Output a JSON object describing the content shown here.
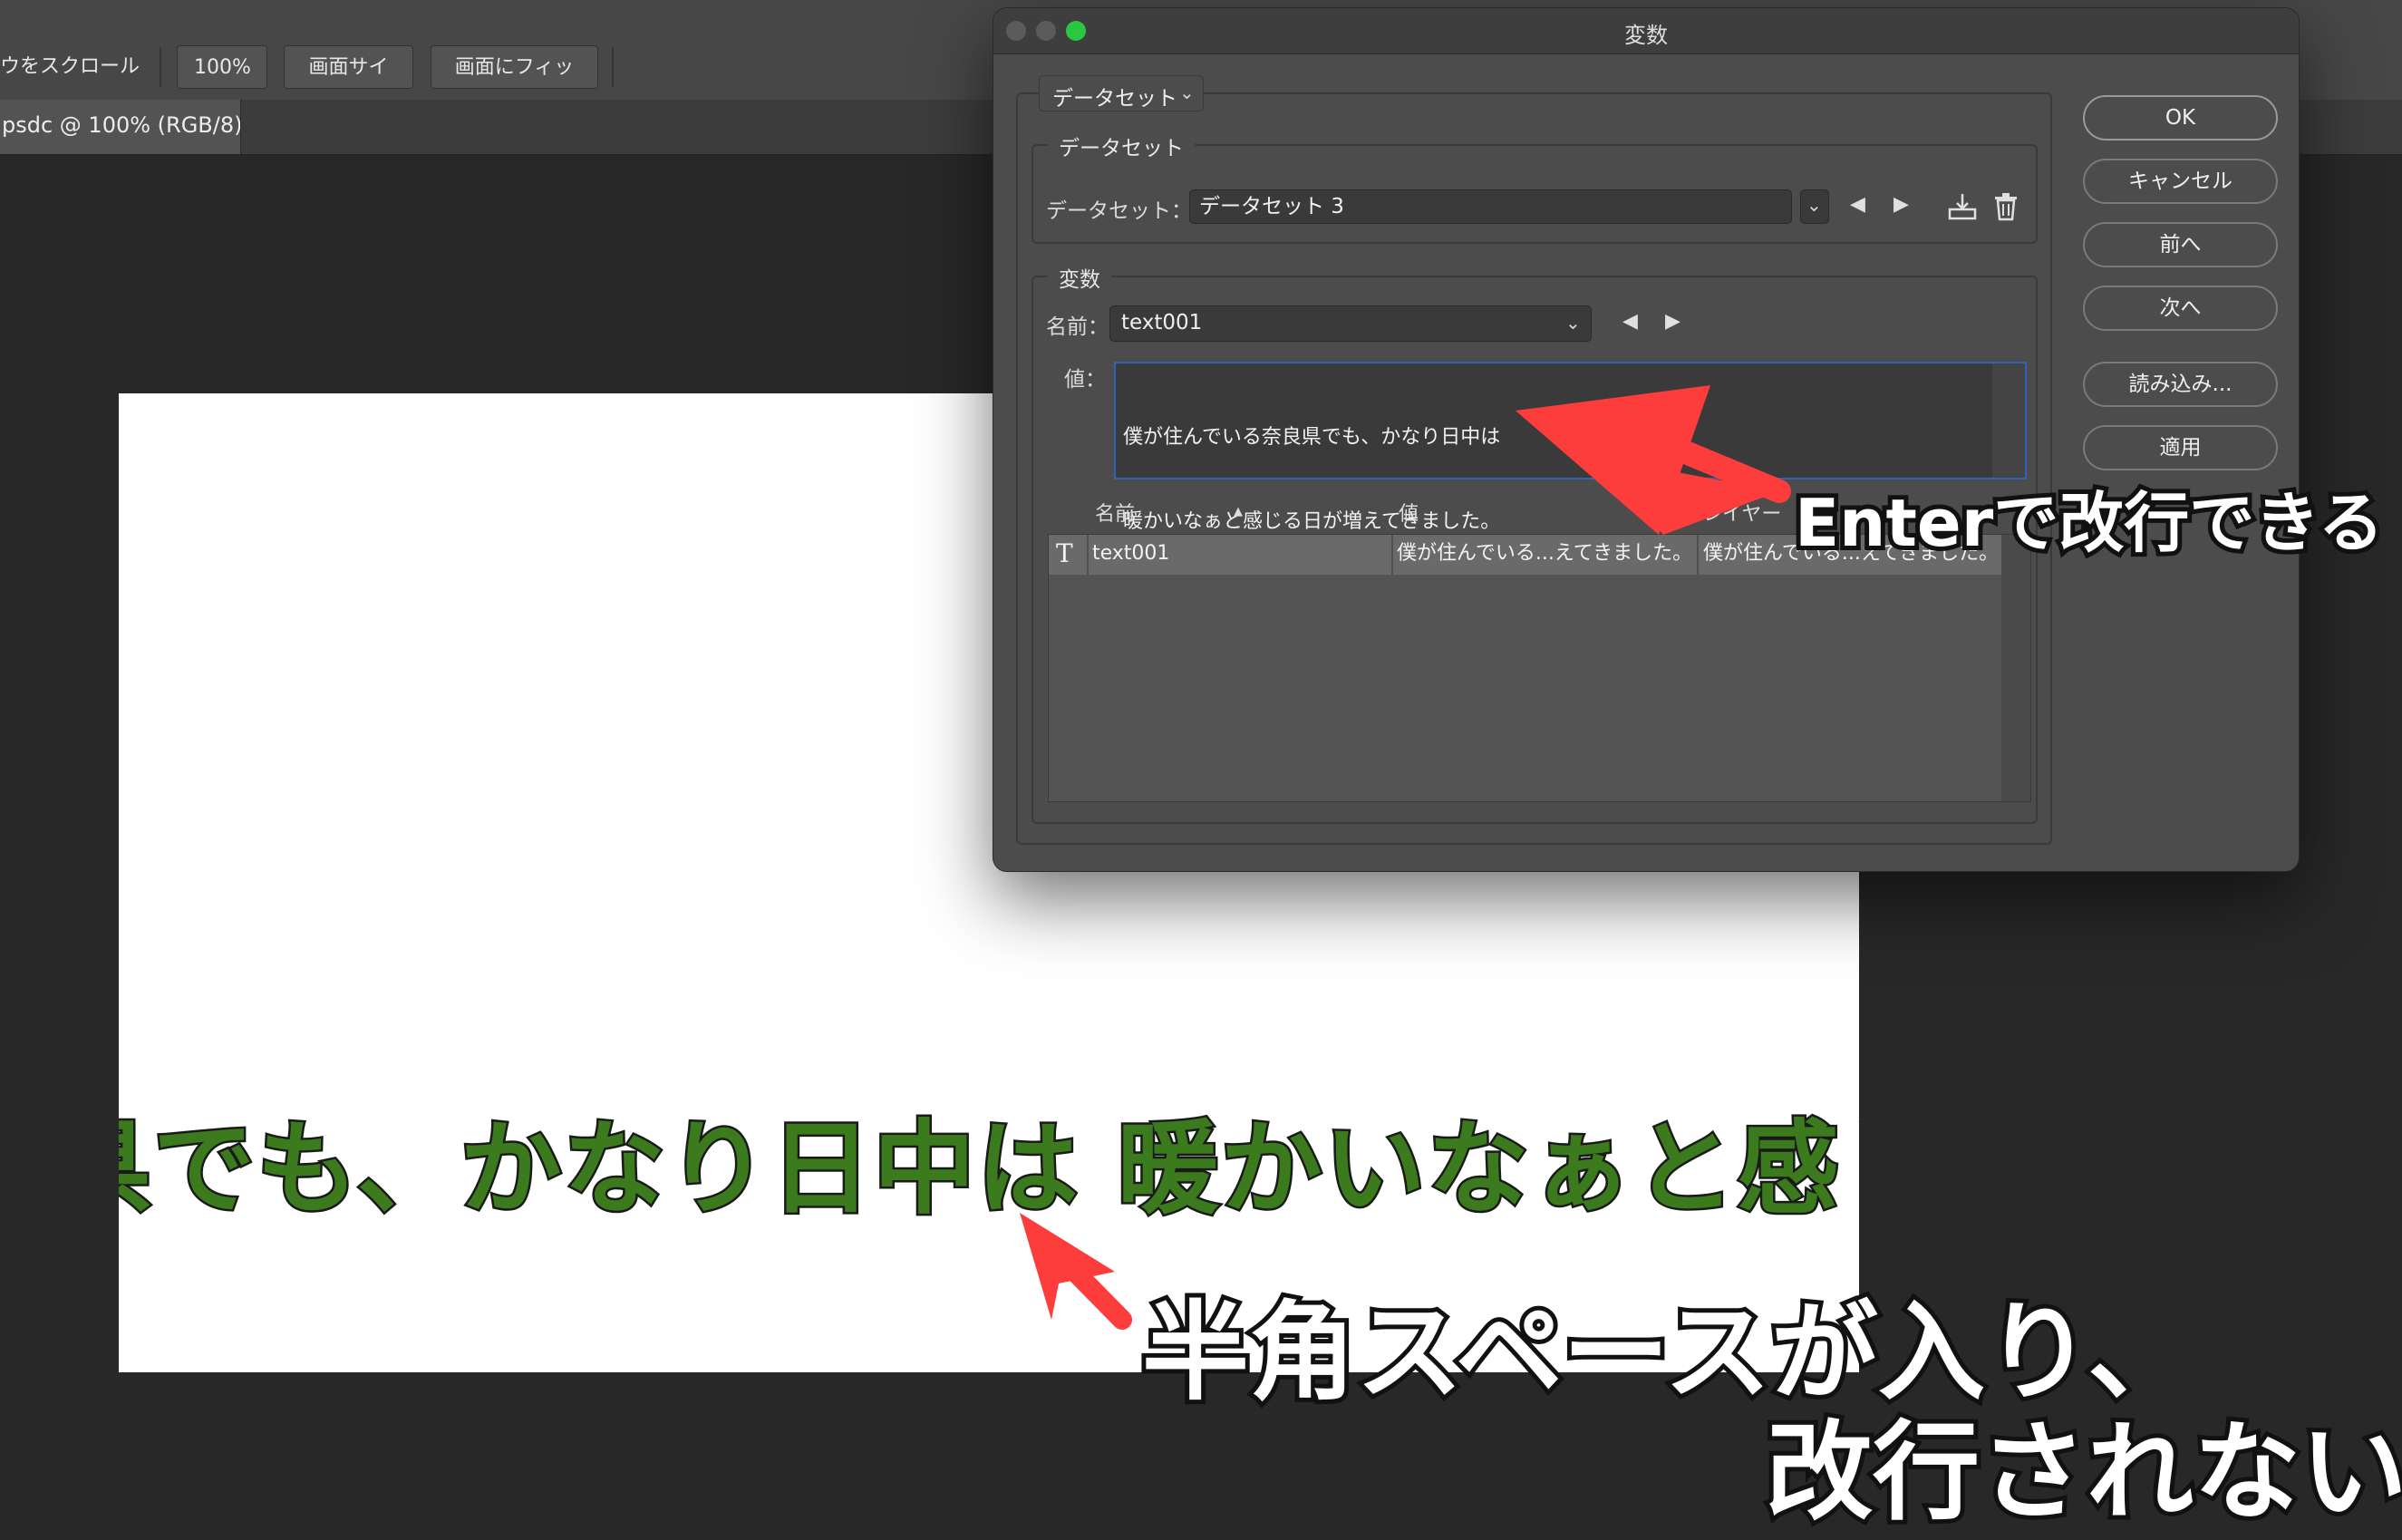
{
  "options_bar": {
    "scroll_label": "ウをスクロール",
    "zoom_button": "100%",
    "screen_size_button": "画面サイズ",
    "fit_screen_button": "画面にフィット"
  },
  "document_tab": {
    "label": "psdc @ 100% (RGB/8)"
  },
  "canvas": {
    "text": "良県でも、かなり日中は 暖かいなぁと感じる日",
    "text_color": "#3c7a1e"
  },
  "dialog": {
    "title": "変数",
    "dataset_dropdown": "データセット",
    "dataset_group": {
      "label": "データセット",
      "field_label": "データセット：",
      "field_value": "データセット 3"
    },
    "variables_group": {
      "label": "変数",
      "name_label": "名前：",
      "name_value": "text001",
      "value_label": "値：",
      "value_lines": [
        "僕が住んでいる奈良県でも、かなり日中は",
        "暖かいなぁと感じる日が増えてきました。"
      ]
    },
    "table": {
      "headers": {
        "name": "名前",
        "value": "値",
        "layer": "レイヤー"
      },
      "rows": [
        {
          "icon": "T",
          "name": "text001",
          "value": "僕が住んでいる...えてきました。",
          "layer": "僕が住んでいる...えてきました。"
        }
      ]
    },
    "buttons": {
      "ok": "OK",
      "cancel": "キャンセル",
      "prev": "前へ",
      "next": "次へ",
      "import": "読み込み...",
      "apply": "適用"
    }
  },
  "annotations": {
    "enter_note": "Enterで改行できる",
    "space_note_line1": "半角スペースが入り、",
    "space_note_line2": "改行されない",
    "arrow_color": "#fd3c3c"
  },
  "colors": {
    "traffic_close": "#5a5a5a",
    "traffic_min": "#5a5a5a",
    "traffic_max": "#2ac840",
    "focus": "#2f63b8"
  }
}
